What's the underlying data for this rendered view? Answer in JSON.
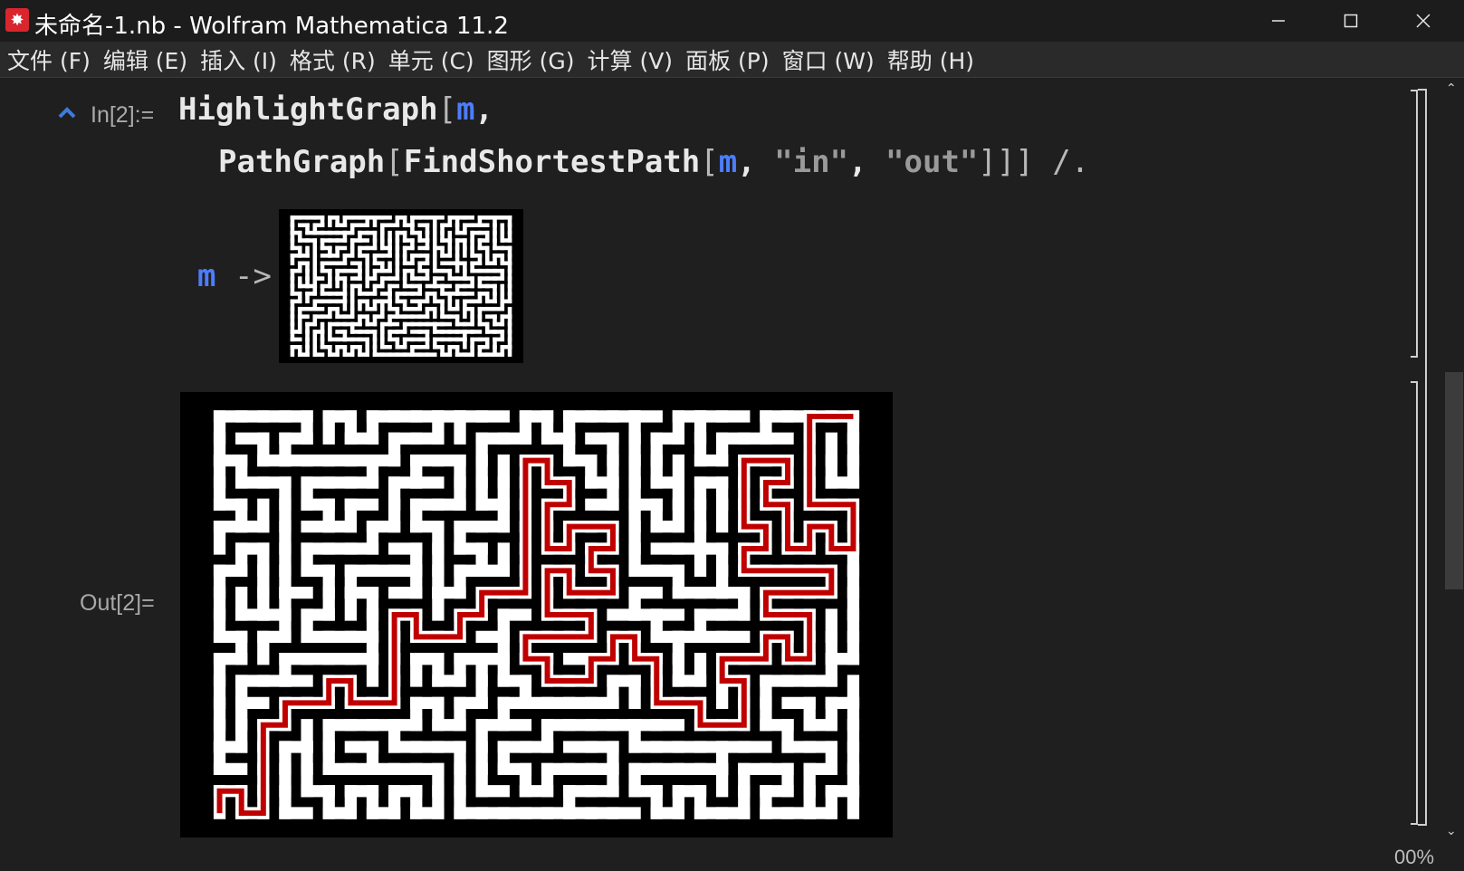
{
  "window": {
    "title": "未命名-1.nb - Wolfram Mathematica 11.2",
    "icon": "mathematica-spikey-icon"
  },
  "menu": [
    {
      "label": "文件 (F)"
    },
    {
      "label": "编辑 (E)"
    },
    {
      "label": "插入 (I)"
    },
    {
      "label": "格式 (R)"
    },
    {
      "label": "单元 (C)"
    },
    {
      "label": "图形 (G)"
    },
    {
      "label": "计算 (V)"
    },
    {
      "label": "面板 (P)"
    },
    {
      "label": "窗口 (W)"
    },
    {
      "label": "帮助 (H)"
    }
  ],
  "cell": {
    "in_label": "In[2]:=",
    "out_label": "Out[2]=",
    "code": {
      "fn1": "HighlightGraph",
      "open1": "[",
      "var1": "m",
      "comma1": ",",
      "fn2": "PathGraph",
      "open2": "[",
      "fn3": "FindShortestPath",
      "open3": "[",
      "var2": "m",
      "comma2": ",",
      "str1": "\"in\"",
      "comma3": ",",
      "str2": "\"out\"",
      "close": "]]]",
      "op": "/.",
      "rule_var": "m",
      "rule_arrow": "->"
    }
  },
  "status": {
    "zoom": "00%"
  },
  "colors": {
    "background": "#1f1f1f",
    "path": "#c00000",
    "variable": "#4d7dff"
  }
}
